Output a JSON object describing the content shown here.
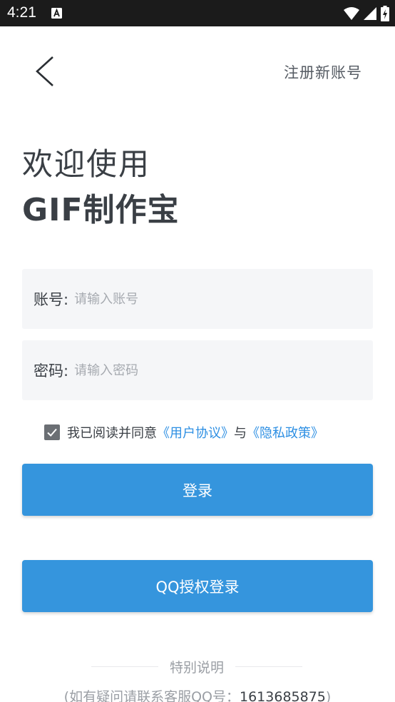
{
  "status_bar": {
    "time": "4:21",
    "icons": [
      "a-notification-icon",
      "wifi-icon",
      "signal-icon",
      "battery-charging-icon"
    ]
  },
  "nav": {
    "back_icon": "chevron-left-icon",
    "register_label": "注册新账号"
  },
  "welcome": {
    "line1": "欢迎使用",
    "line2": "GIF制作宝"
  },
  "form": {
    "account_label": "账号:",
    "account_placeholder": "请输入账号",
    "account_value": "",
    "password_label": "密码:",
    "password_placeholder": "请输入密码",
    "password_value": ""
  },
  "agreement": {
    "checked": true,
    "prefix": "我已阅读并同意",
    "user_agreement": "《用户协议》",
    "conjunction": "与",
    "privacy_policy": "《隐私政策》"
  },
  "buttons": {
    "login": "登录",
    "qq_login": "QQ授权登录"
  },
  "footer": {
    "note_title": "特别说明",
    "note_prefix": "(如有疑问请联系客服QQ号：",
    "qq_number": "1613685875",
    "note_suffix": ")"
  },
  "colors": {
    "accent": "#3595dd",
    "link": "#2d8fe3",
    "status_bar": "#1b1b1b",
    "input_bg": "#f5f6f8"
  }
}
